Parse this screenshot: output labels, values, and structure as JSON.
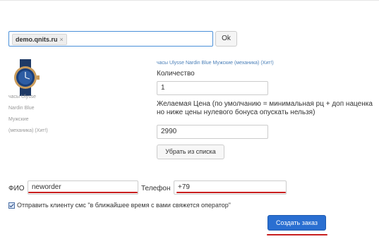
{
  "site_selector": {
    "tag": "demo.qnits.ru",
    "remove_glyph": "×",
    "ok_label": "Ok"
  },
  "product": {
    "link": "часы Ulysse Nardin Blue Мужские (механика) (Хит!)",
    "caption_lines": [
      "часы Ulysse",
      "Nardin Blue",
      "Мужские",
      "(механика) (Хит!)"
    ],
    "image_icon": "watch-icon"
  },
  "form": {
    "quantity_label": "Количество",
    "quantity_value": "1",
    "price_hint_1": "Желаемая Цена (по умолчанию = минимальная рц + доп наценка",
    "price_hint_2": "но ниже цены нулевого бонуса опускать нельзя)",
    "price_value": "2990",
    "remove_label": "Убрать из списка",
    "fio_label": "ФИО",
    "fio_value": "neworder",
    "phone_label": "Телефон",
    "phone_value": "+79",
    "sms_label": "Отправить клиенту смс \"в ближайшее время с вами свяжется оператор\"",
    "sms_checked": true,
    "create_label": "Создать заказ"
  },
  "colors": {
    "primary": "#2a6fd1",
    "link": "#4a7fb8",
    "annotation_underline": "#c81e1e"
  }
}
